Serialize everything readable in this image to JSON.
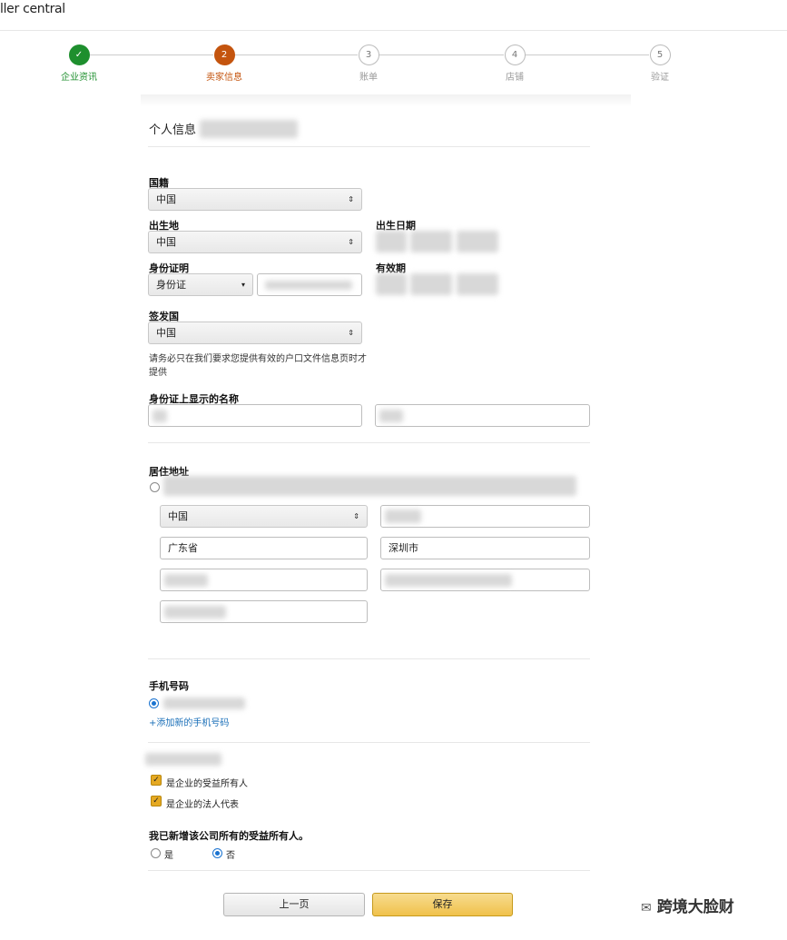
{
  "header": {
    "brand": "ller central"
  },
  "stepper": {
    "steps": [
      {
        "num": "✓",
        "label": "企业资讯",
        "state": "done"
      },
      {
        "num": "2",
        "label": "卖家信息",
        "state": "current"
      },
      {
        "num": "3",
        "label": "账单",
        "state": "todo"
      },
      {
        "num": "4",
        "label": "店铺",
        "state": "todo"
      },
      {
        "num": "5",
        "label": "验证",
        "state": "todo"
      }
    ],
    "colors": {
      "done": "#1e8f2e",
      "current": "#c4540e"
    }
  },
  "personal": {
    "title": "个人信息",
    "nationality_label": "国籍",
    "nationality_value": "中国",
    "birthplace_label": "出生地",
    "birthplace_value": "中国",
    "birthdate_label": "出生日期",
    "id_label": "身份证明",
    "id_type_value": "身份证",
    "expiry_label": "有效期",
    "issuer_label": "签发国",
    "issuer_value": "中国",
    "hint": "请务必只在我们要求您提供有效的户口文件信息页时才提供",
    "name_on_id_label": "身份证上显示的名称"
  },
  "address": {
    "label": "居住地址",
    "country_value": "中国",
    "province_value": "广东省",
    "city_value": "深圳市"
  },
  "phone": {
    "label": "手机号码",
    "add_link": "+添加新的手机号码"
  },
  "roles": {
    "beneficial_owner": "是企业的受益所有人",
    "legal_rep": "是企业的法人代表"
  },
  "all_owners": {
    "question": "我已新增该公司所有的受益所有人。",
    "yes": "是",
    "no": "否",
    "selected": "否"
  },
  "footer": {
    "prev_label": "上一页",
    "save_label": "保存"
  },
  "watermark": {
    "text": "跨境大脸财"
  }
}
